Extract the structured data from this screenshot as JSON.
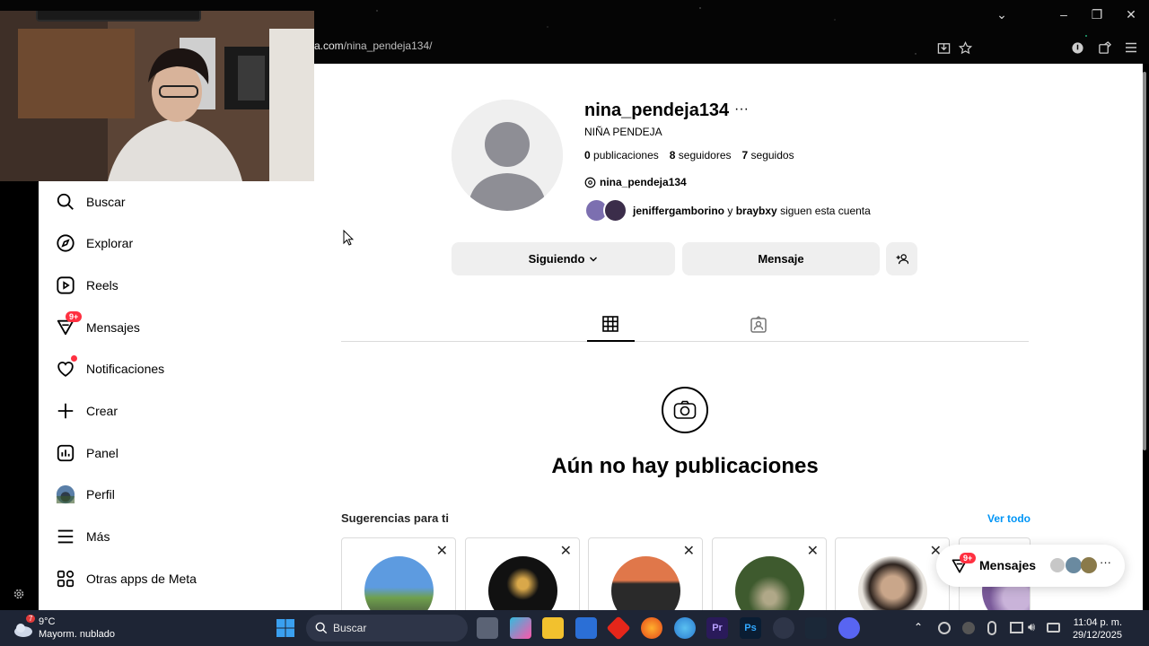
{
  "browser": {
    "url_domain": "a.com",
    "url_path": "/nina_pendeja134/"
  },
  "sidebar": {
    "items": [
      {
        "label": "Buscar",
        "icon": "search-icon"
      },
      {
        "label": "Explorar",
        "icon": "compass-icon"
      },
      {
        "label": "Reels",
        "icon": "reels-icon"
      },
      {
        "label": "Mensajes",
        "icon": "messenger-icon",
        "badge": "9+"
      },
      {
        "label": "Notificaciones",
        "icon": "heart-icon"
      },
      {
        "label": "Crear",
        "icon": "plus-icon"
      },
      {
        "label": "Panel",
        "icon": "dashboard-icon"
      },
      {
        "label": "Perfil",
        "icon": "avatar-icon"
      },
      {
        "label": "Más",
        "icon": "menu-icon"
      },
      {
        "label": "Otras apps de Meta",
        "icon": "apps-icon"
      }
    ]
  },
  "profile": {
    "username": "nina_pendeja134",
    "full_name": "NIÑA PENDEJA",
    "posts_count": "0",
    "posts_label": "publicaciones",
    "followers_count": "8",
    "followers_label": "seguidores",
    "following_count": "7",
    "following_label": "seguidos",
    "threads_handle": "nina_pendeja134",
    "followed_by_1": "jeniffergamborino",
    "followed_by_and": "y",
    "followed_by_2": "braybxy",
    "followed_by_suffix": "siguen esta cuenta"
  },
  "actions": {
    "following_label": "Siguiendo",
    "message_label": "Mensaje"
  },
  "empty_state": {
    "text": "Aún no hay publicaciones"
  },
  "suggestions": {
    "title": "Sugerencias para ti",
    "see_all": "Ver todo"
  },
  "messages_pill": {
    "label": "Mensajes",
    "badge": "9+"
  },
  "taskbar": {
    "weather_temp": "9°C",
    "weather_desc": "Mayorm. nublado",
    "weather_badge": "7",
    "search_label": "Buscar",
    "time": "11:04 p. m.",
    "date": "29/12/2025"
  },
  "colors": {
    "accent_blue": "#0095f6",
    "notification_red": "#ff3040",
    "button_gray": "#efefef"
  }
}
